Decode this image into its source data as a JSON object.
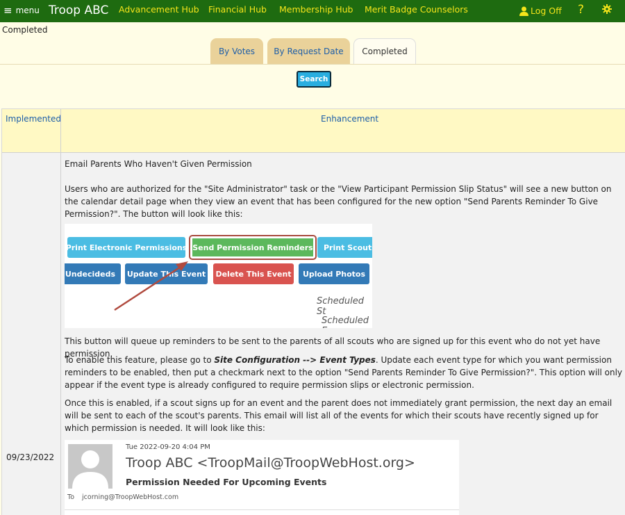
{
  "nav": {
    "menu_label": "menu",
    "brand": "Troop ABC",
    "links": [
      "Advancement Hub",
      "Financial Hub",
      "Membership Hub",
      "Merit Badge Counselors"
    ],
    "logoff": "Log Off",
    "help": "?"
  },
  "page_title": "Completed",
  "tabs": [
    {
      "label": "By Votes",
      "active": false
    },
    {
      "label": "By Request Date",
      "active": false
    },
    {
      "label": "Completed",
      "active": true
    }
  ],
  "search_label": "Search",
  "table": {
    "headers": [
      "Implemented",
      "Enhancement"
    ],
    "row": {
      "date": "09/23/2022",
      "title": "Email Parents Who Haven't Given Permission",
      "para1": "Users who are authorized for the \"Site Administrator\" task or the \"View Participant Permission Slip Status\" will see a new button on the calendar detail page when they view an event that has been configured for the new option \"Send Parents Reminder To Give Permission?\".  The button will look like this:",
      "para2": "This button will queue up reminders to be sent to the parents of all scouts who are signed up for this event who do not yet have permission.",
      "para3_a": "To enable this feature, please go to ",
      "para3_link": "Site Configuration --> Event Types",
      "para3_b": ".  Update each event type for which you want permission reminders to be enabled, then put a checkmark next to the option \"Send Parents Reminder To Give Permission?\".  This option will only appear if the event type is already configured to require permission slips or electronic permission.",
      "para4": "Once this is enabled, if a scout signs up for an event and the parent does not immediately grant permission, the next day an email will be sent to each of the scout's parents.  This email will list all of the events for which their scouts have recently signed up for which permission is needed.  It will look like this:"
    }
  },
  "illustration1": {
    "buttons": [
      "Print Electronic Permissions",
      "Send Permission Reminders",
      "Print Scouts I",
      "e Undecideds",
      "Update This Event",
      "Delete This Event",
      "Upload Photos"
    ],
    "sched1": "Scheduled St",
    "sched2": "Scheduled E"
  },
  "illustration2": {
    "timestamp": "Tue 2022-09-20 4:04 PM",
    "from": "Troop ABC <TroopMail@TroopWebHost.org>",
    "subject": "Permission Needed For Upcoming Events",
    "to_label": "To",
    "to_addr": "jcorning@TroopWebHost.com"
  },
  "colors": {
    "nav_bg": "#1e6b10",
    "nav_link": "#f5e51a",
    "page_bg": "#fffde6",
    "header_bg": "#fff9c4",
    "link_blue": "#1d5ea8",
    "btn_cyan": "#4bbde3",
    "btn_green": "#5cb85c",
    "btn_blue": "#337ab7",
    "btn_red": "#d9534f"
  }
}
